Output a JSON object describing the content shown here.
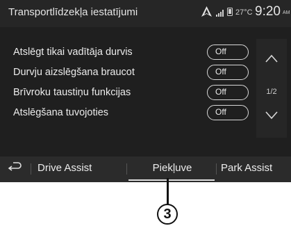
{
  "header": {
    "title": "Transportlīdzekļa iestatījumi",
    "temperature": "27°C",
    "time": "9:20",
    "ampm": "AM"
  },
  "settings": [
    {
      "label": "Atslēgt tikai vadītāja durvis",
      "value": "Off"
    },
    {
      "label": "Durvju aizslēgšana braucot",
      "value": "Off"
    },
    {
      "label": "Brīvroku taustiņu funkcijas",
      "value": "Off"
    },
    {
      "label": "Atslēgšana tuvojoties",
      "value": "Off"
    }
  ],
  "pagination": {
    "indicator": "1/2"
  },
  "tabs": {
    "drive_assist": "Drive Assist",
    "piekluve": "Piekļuve",
    "park_assist": "Park Assist",
    "active": "piekluve"
  },
  "callout": {
    "number": "3"
  },
  "colors": {
    "background": "#1f1f1f",
    "text": "#ececec"
  },
  "icons": {
    "back": "back-arrow-icon",
    "scroll_up": "chevron-up-icon",
    "scroll_down": "chevron-down-icon",
    "nav": "navigation-arrow-icon",
    "signal": "signal-icon",
    "phone": "phone-icon"
  }
}
